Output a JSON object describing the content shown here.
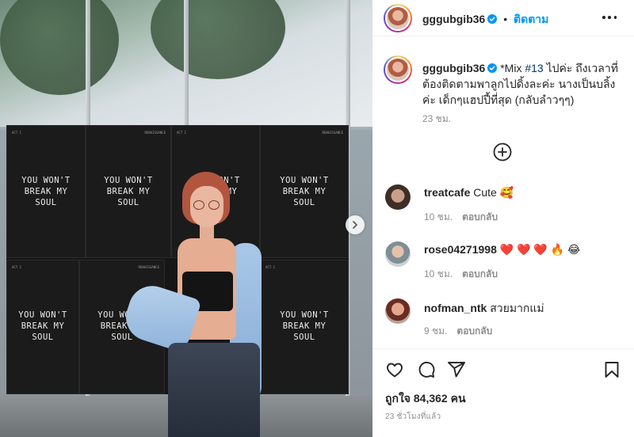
{
  "post": {
    "username": "gggubgib36",
    "follow_label": "ติดตาม",
    "separator": "•",
    "caption": {
      "username": "gggubgib36",
      "text_before": "*Mix ",
      "hashtag": "#13",
      "text_after": " ไปค่ะ ถึงเวลาที่ต้องติดตามพาลูกไปดิ้งละค่ะ นางเป็นบลิ้งค่ะ เด็กๆแฮปปี้ที่สุด (กลับลำวๆๆ)",
      "time": "23 ชม."
    },
    "comments": [
      {
        "username": "treatcafe",
        "text": "Cute 🥰",
        "time": "10 ชม.",
        "reply_label": "ตอบกลับ"
      },
      {
        "username": "rose04271998",
        "text": "❤️ ❤️ ❤️ 🔥 😂",
        "time": "10 ชม.",
        "reply_label": "ตอบกลับ"
      },
      {
        "username": "nofman_ntk",
        "text": "สวยมากแม่",
        "time": "9 ชม.",
        "reply_label": "ตอบกลับ"
      }
    ],
    "likes_label": "ถูกใจ 84,362 คน",
    "posted_ago": "23 ชั่วโมงที่แล้ว"
  },
  "photo": {
    "poster_text": "YOU WON'T\nBREAK MY\nSOUL",
    "poster_small_left": "ACT I",
    "poster_small_right": "RENAISSANCE"
  },
  "icons": {
    "verified": "verified-badge-icon",
    "more": "more-options-icon",
    "add_comments": "plus-circle-icon",
    "like": "heart-icon",
    "comment": "comment-icon",
    "share": "share-icon",
    "save": "bookmark-icon",
    "next": "chevron-right-icon"
  },
  "colors": {
    "link_blue": "#0095f6",
    "hashtag": "#00376b",
    "muted": "#8e8e8e",
    "text": "#262626"
  }
}
